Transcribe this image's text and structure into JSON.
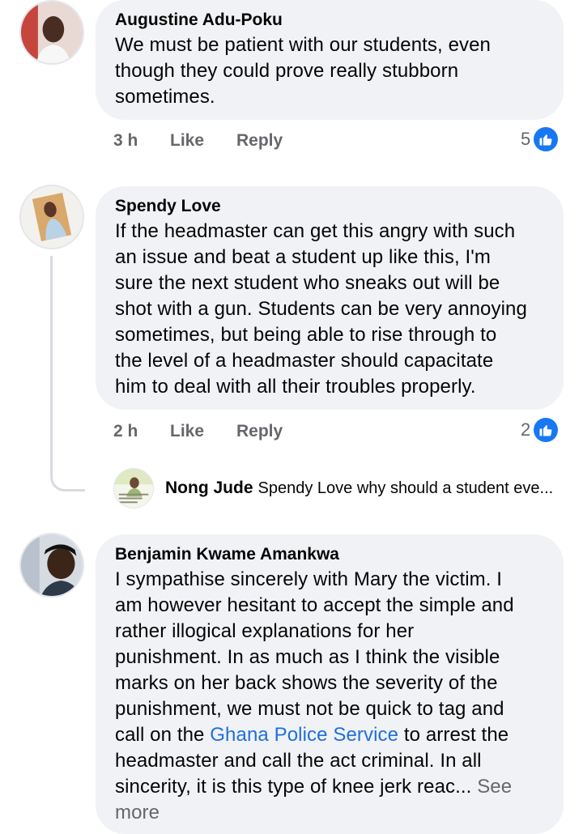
{
  "comments": [
    {
      "author": "Augustine Adu-Poku",
      "lines": [
        "We must be patient with our students, even",
        "though they could prove really stubborn",
        "sometimes."
      ],
      "time": "3 h",
      "like_label": "Like",
      "reply_label": "Reply",
      "reaction_count": "5"
    },
    {
      "author": "Spendy Love",
      "lines": [
        "If the headmaster can get this angry with such",
        "an issue and beat a student up like this, I'm",
        "sure the next student who sneaks out will be",
        "shot with a gun. Students can be very annoying",
        "sometimes, but being able to rise through to",
        "the level of a headmaster should capacitate",
        "him to deal with all their troubles properly."
      ],
      "time": "2 h",
      "like_label": "Like",
      "reply_label": "Reply",
      "reaction_count": "2",
      "reply_preview": {
        "author": "Nong Jude",
        "text": "Spendy Love why should a student eve..."
      }
    },
    {
      "author": "Benjamin Kwame Amankwa",
      "lines": [
        "I sympathise sincerely with Mary the victim. I",
        "am however hesitant to accept the simple and",
        "rather illogical explanations for her",
        "punishment. In as much as I think the visible",
        "marks on her back shows the severity of the",
        "punishment, we must not be quick to tag and"
      ],
      "line7_before": "call on the ",
      "line7_link": "Ghana Police Service",
      "line7_after": " to arrest the",
      "line8": "headmaster and call the act criminal. In all",
      "line9": "sincerity, it is this type of knee jerk reac... ",
      "see_more_a": "See",
      "see_more_b": "more"
    }
  ],
  "colors": {
    "bubble": "#f0f2f5",
    "link": "#216fdb",
    "like_badge": "#1877f2",
    "meta_text": "#65676b"
  },
  "icons": [
    "avatar",
    "like-thumb-icon"
  ]
}
